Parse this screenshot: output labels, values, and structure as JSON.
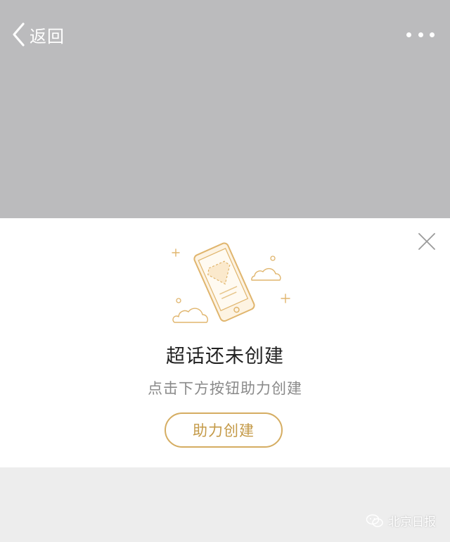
{
  "nav": {
    "back_label": "返回",
    "back_icon": "chevron-left-icon",
    "more_icon": "more-dots-icon"
  },
  "empty_state": {
    "title": "超话还未创建",
    "subtitle": "点击下方按钮助力创建",
    "button_label": "助力创建",
    "close_icon": "close-icon",
    "illustration_icon": "phone-diamond-illustration"
  },
  "watermark": {
    "label": "北京日报",
    "icon": "wechat-icon"
  },
  "colors": {
    "header_bg": "#bbbbbd",
    "accent": "#d5ad62",
    "page_bg": "#ededed"
  }
}
